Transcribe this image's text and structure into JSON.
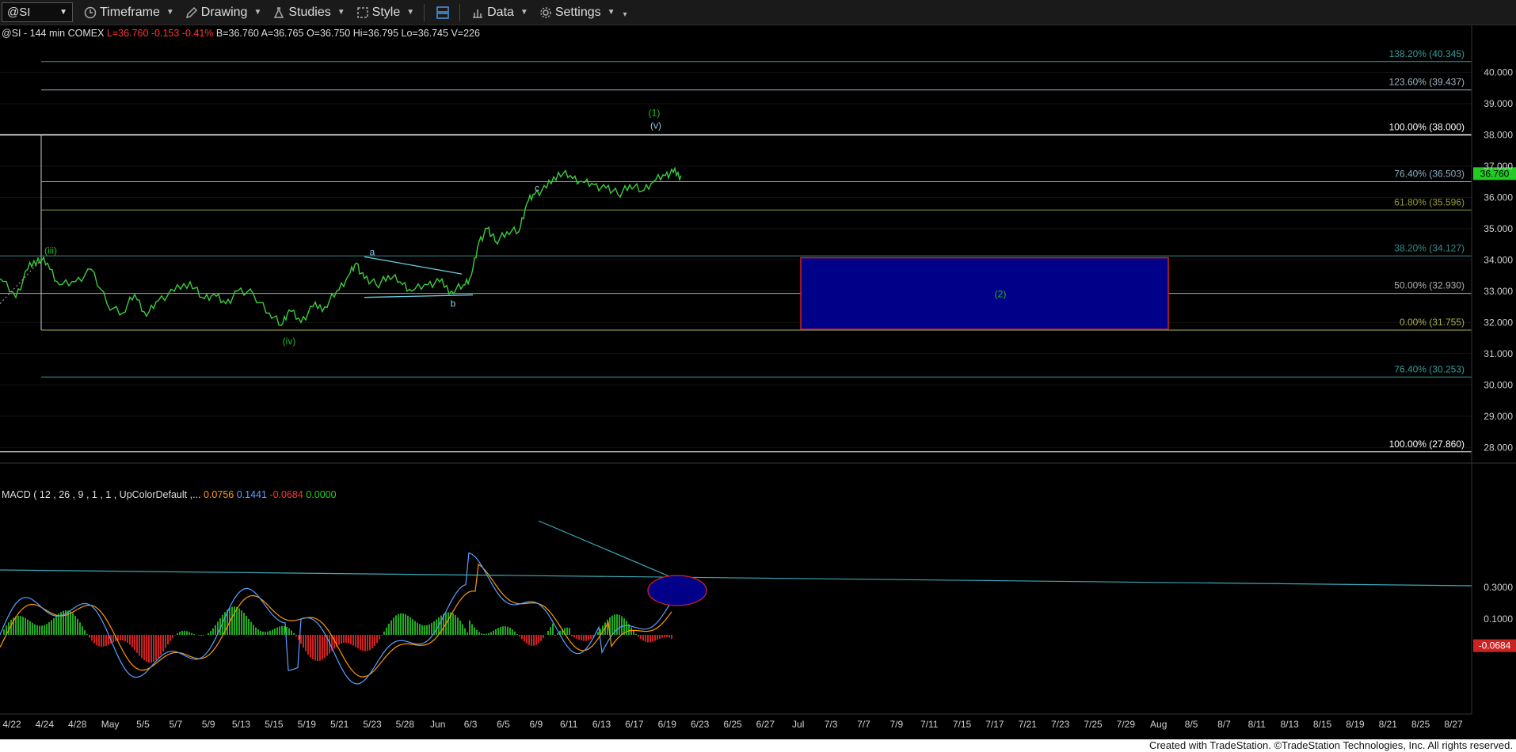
{
  "toolbar": {
    "symbol": "@SI",
    "items": [
      "Timeframe",
      "Drawing",
      "Studies",
      "Style",
      "Data",
      "Settings"
    ]
  },
  "quote": {
    "symbol": "@SI",
    "interval": "144 min",
    "exchange": "COMEX",
    "last": "L=36.760",
    "change": "-0.153",
    "change_pct": "-0.41%",
    "bid": "B=36.760",
    "ask": "A=36.765",
    "open": "O=36.750",
    "high": "Hi=36.795",
    "low": "Lo=36.745",
    "volume": "V=226"
  },
  "price_axis": {
    "labels": [
      "40.000",
      "39.000",
      "38.000",
      "37.000",
      "36.000",
      "35.000",
      "34.000",
      "33.000",
      "32.000",
      "31.000",
      "30.000",
      "29.000",
      "28.000"
    ],
    "range": [
      27.5,
      41.2
    ],
    "last_price_tag": "36.760"
  },
  "fib_levels": [
    {
      "price": 40.345,
      "label": "138.20% (40.345)",
      "color": "#3a9a9a"
    },
    {
      "price": 39.437,
      "label": "123.60% (39.437)",
      "color": "#9ab6c8"
    },
    {
      "price": 38.0,
      "label": "100.00% (38.000)",
      "color": "#ffffff"
    },
    {
      "price": 36.503,
      "label": "76.40% (36.503)",
      "color": "#8ab0c0"
    },
    {
      "price": 35.596,
      "label": "61.80% (35.596)",
      "color": "#9a9a3a"
    },
    {
      "price": 34.127,
      "label": "38.20% (34.127)",
      "color": "#3a8a8a"
    },
    {
      "price": 32.93,
      "label": "50.00% (32.930)",
      "color": "#b0b0b0"
    },
    {
      "price": 31.755,
      "label": "0.00% (31.755)",
      "color": "#b0b050"
    },
    {
      "price": 30.253,
      "label": "76.40% (30.253)",
      "color": "#3a9a9a"
    },
    {
      "price": 27.86,
      "label": "100.00% (27.860)",
      "color": "#ffffff"
    }
  ],
  "wave_labels": [
    {
      "text": "(iii)",
      "color": "#22bb22"
    },
    {
      "text": "(iv)",
      "color": "#22bb22"
    },
    {
      "text": "a",
      "color": "#8ecae6"
    },
    {
      "text": "b",
      "color": "#8ecae6"
    },
    {
      "text": "c",
      "color": "#8ecae6"
    },
    {
      "text": "(1)",
      "color": "#22bb22"
    },
    {
      "text": "(v)",
      "color": "#8ecae6"
    },
    {
      "text": "(2)",
      "color": "#22bb22"
    }
  ],
  "target_box": {
    "top": 34.07,
    "bottom": 31.78,
    "fill": "#000088",
    "border": "#cc2222"
  },
  "macd": {
    "title": "MACD ( 12 , 26 , 9 , 1 , 1 , UpColorDefault ,...",
    "v1": "0.0756",
    "v2": "0.1441",
    "v3": "-0.0684",
    "v4": "0.0000",
    "axis_labels": [
      "0.3000",
      "0.1000"
    ],
    "range": [
      -0.5,
      0.8
    ],
    "last_tag": "-0.0684"
  },
  "date_axis": [
    "4/22",
    "4/24",
    "4/28",
    "May",
    "5/5",
    "5/7",
    "5/9",
    "5/13",
    "5/15",
    "5/19",
    "5/21",
    "5/23",
    "5/28",
    "Jun",
    "6/3",
    "6/5",
    "6/9",
    "6/11",
    "6/13",
    "6/17",
    "6/19",
    "6/23",
    "6/25",
    "6/27",
    "Jul",
    "7/3",
    "7/7",
    "7/9",
    "7/11",
    "7/15",
    "7/17",
    "7/21",
    "7/23",
    "7/25",
    "7/29",
    "Aug",
    "8/5",
    "8/7",
    "8/11",
    "8/13",
    "8/15",
    "8/19",
    "8/21",
    "8/25",
    "8/27"
  ],
  "footer": "Created with TradeStation. ©TradeStation Technologies, Inc. All rights reserved."
}
